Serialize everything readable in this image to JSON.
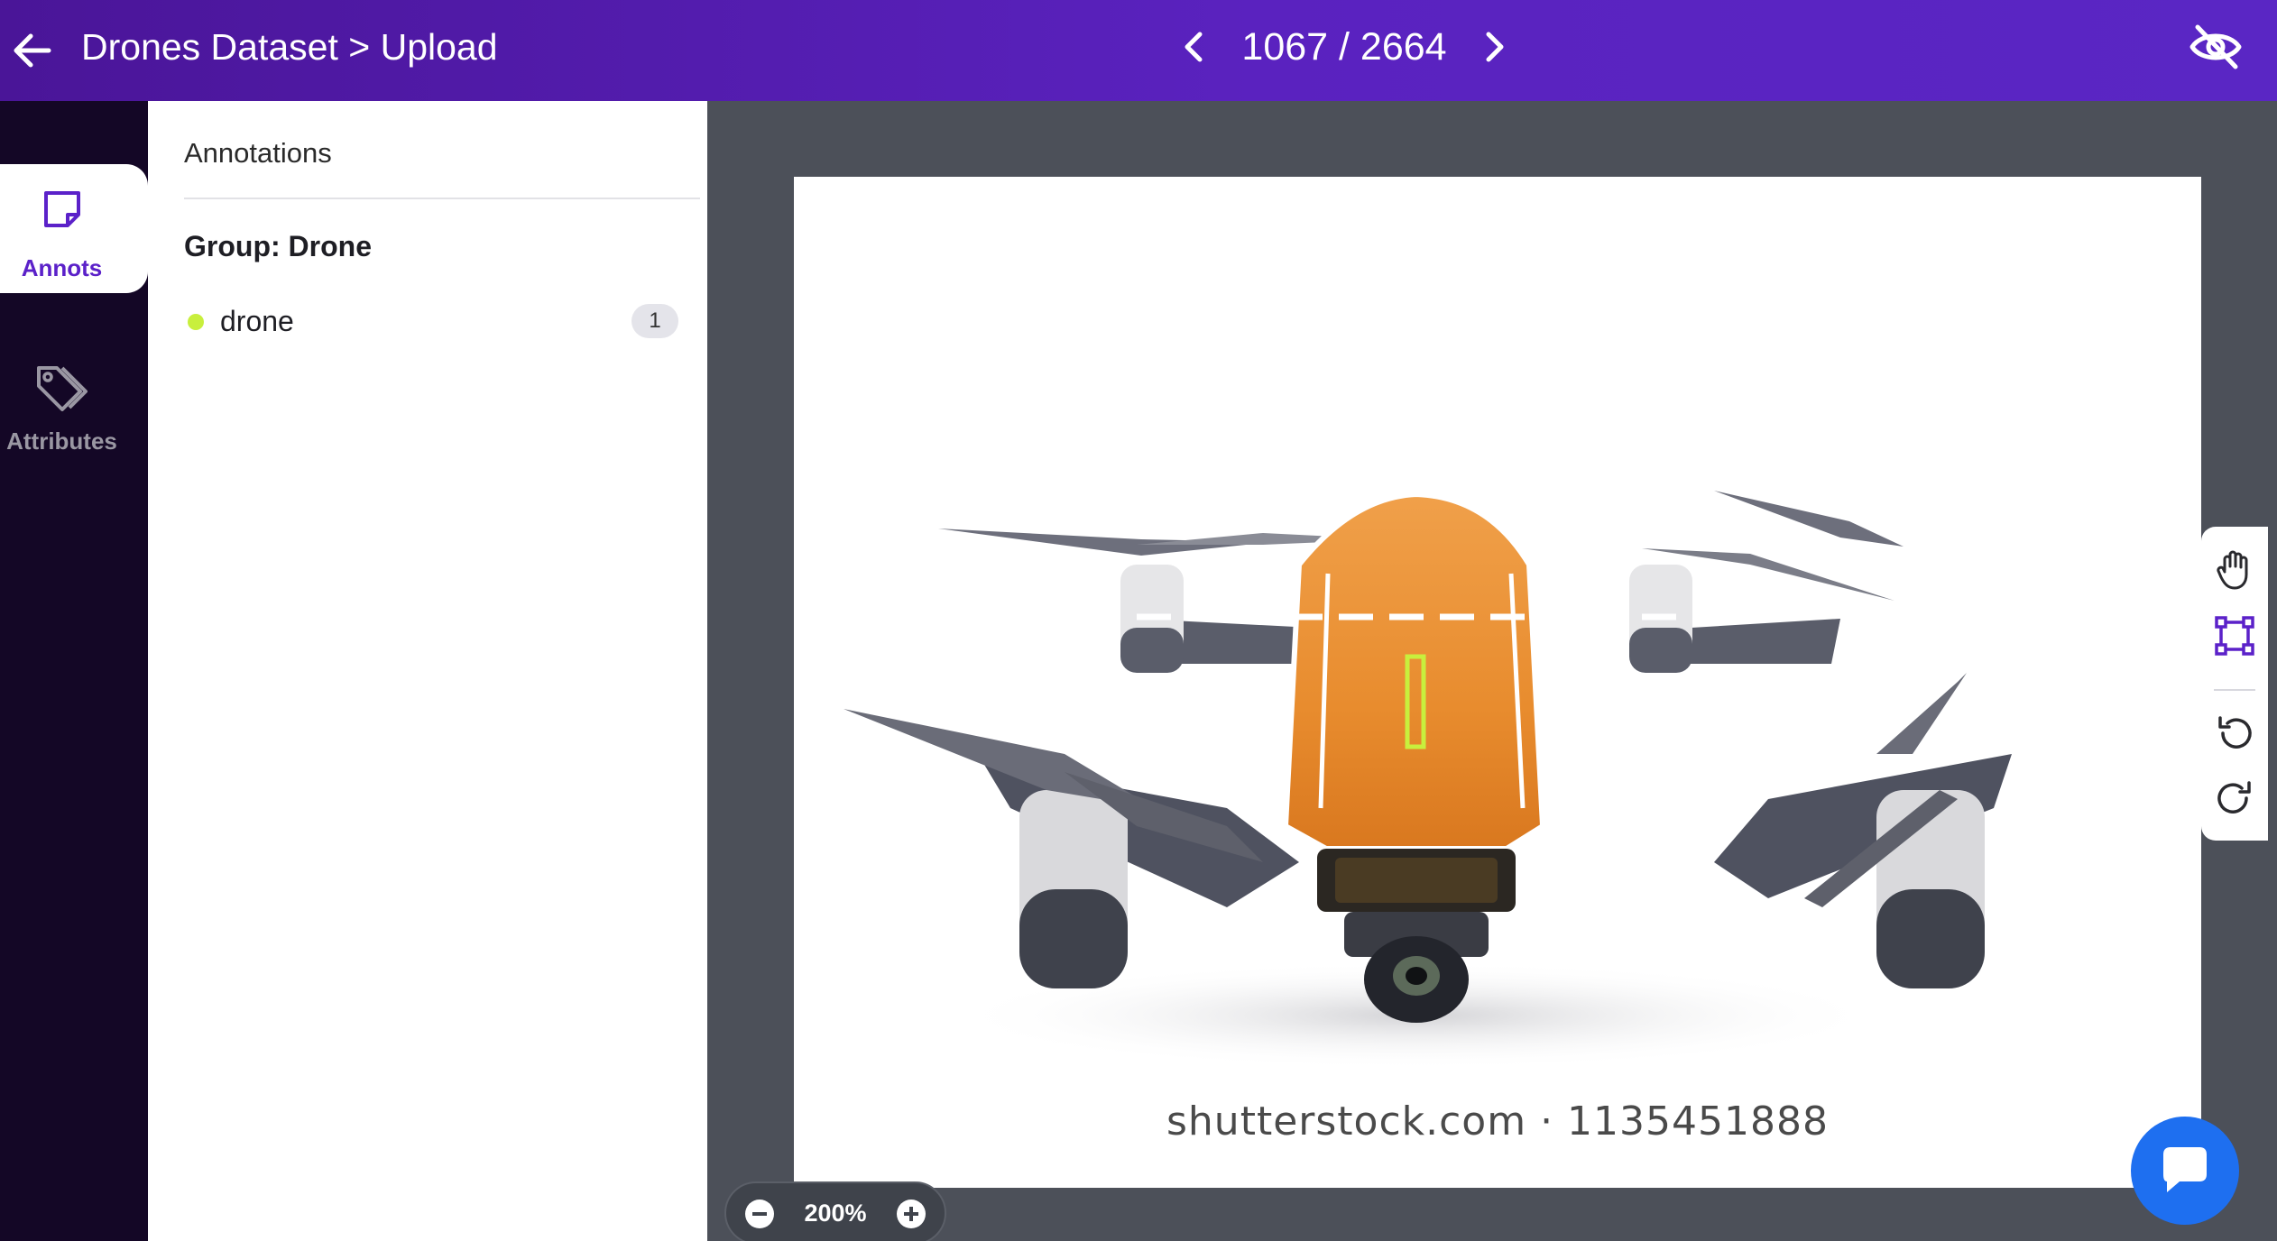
{
  "header": {
    "title": "Drones Dataset > Upload",
    "pager": {
      "current": 1067,
      "total": 2664,
      "text": "1067 / 2664"
    }
  },
  "leftnav": {
    "items": [
      {
        "label": "Annots",
        "icon": "sticky-note-icon",
        "active": true
      },
      {
        "label": "Attributes",
        "icon": "tags-icon",
        "active": false
      }
    ]
  },
  "panel": {
    "header": "Annotations",
    "group_title": "Group: Drone",
    "classes": [
      {
        "name": "drone",
        "count": "1",
        "color": "#c8ef3d"
      }
    ]
  },
  "canvas": {
    "watermark": "shutterstock.com · 1135451888",
    "zoom_label": "200%"
  },
  "tools": [
    "hand-icon",
    "bounding-box-icon",
    "undo-icon",
    "redo-icon"
  ],
  "colors": {
    "header_start": "#4a1598",
    "header_end": "#5a26c4",
    "nav_bg": "#140726",
    "accent": "#5b21c9",
    "canvas_bg": "#4c5059",
    "annotation": "#c8ef3d",
    "chat": "#1e6ff0"
  }
}
